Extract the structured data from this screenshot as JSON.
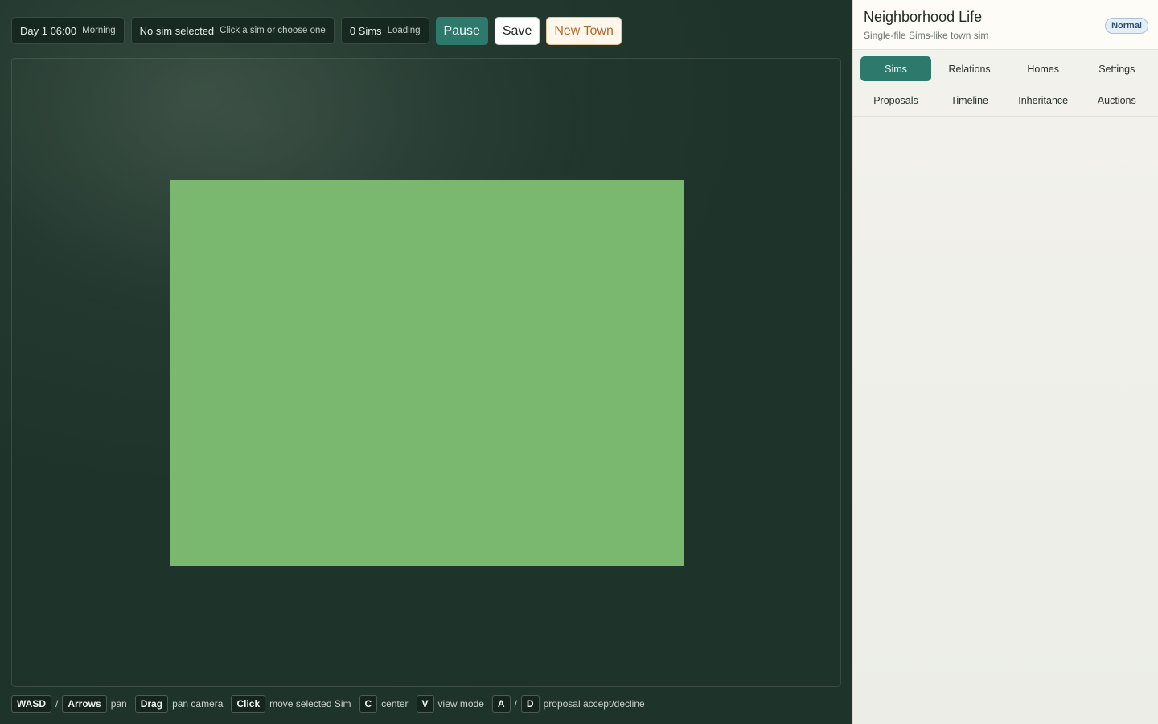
{
  "status": {
    "time": "Day 1 06:00",
    "period": "Morning",
    "selection": "No sim selected",
    "selection_hint": "Click a sim or choose one",
    "sims_count": "0 Sims",
    "sims_state": "Loading"
  },
  "toolbar": {
    "pause_label": "Pause",
    "save_label": "Save",
    "new_town_label": "New Town"
  },
  "hints": {
    "wasd": "WASD",
    "slash": "/",
    "arrows": "Arrows",
    "pan": "pan",
    "drag": "Drag",
    "pan_camera": "pan camera",
    "click": "Click",
    "move_sim": "move selected Sim",
    "c_key": "C",
    "center": "center",
    "v_key": "V",
    "view_mode": "view mode",
    "a_key": "A",
    "d_key": "D",
    "proposal": "proposal accept/decline"
  },
  "panel": {
    "title": "Neighborhood Life",
    "subtitle": "Single-file Sims-like town sim",
    "badge": "Normal",
    "tabs": [
      {
        "label": "Sims"
      },
      {
        "label": "Relations"
      },
      {
        "label": "Homes"
      },
      {
        "label": "Settings"
      },
      {
        "label": "Proposals"
      },
      {
        "label": "Timeline"
      },
      {
        "label": "Inheritance"
      },
      {
        "label": "Auctions"
      }
    ],
    "active_tab": "Sims"
  },
  "colors": {
    "accent": "#2d7a6c",
    "map_grass": "#7bb86f",
    "new_town": "#b4682c"
  }
}
